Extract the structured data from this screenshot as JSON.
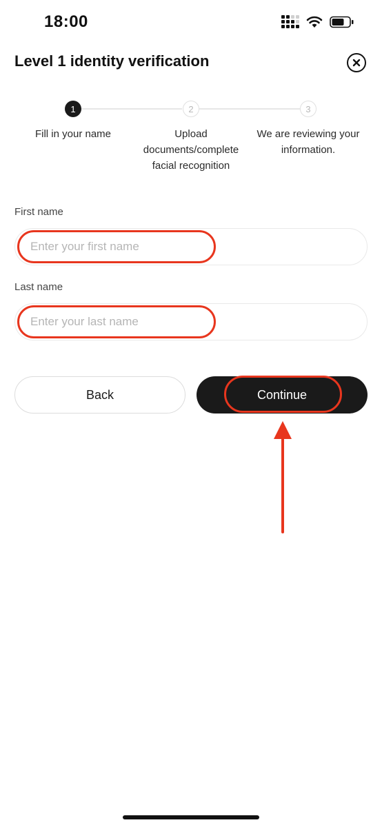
{
  "status_bar": {
    "time": "18:00",
    "signal_icon": "cellular-signal-icon",
    "wifi_icon": "wifi-icon",
    "battery_icon": "battery-icon"
  },
  "header": {
    "title": "Level 1 identity verification",
    "close_icon": "close-circle-icon"
  },
  "stepper": {
    "steps": [
      {
        "number": "1",
        "label": "Fill in your name",
        "active": true
      },
      {
        "number": "2",
        "label": "Upload documents/complete facial recognition",
        "active": false
      },
      {
        "number": "3",
        "label": "We are reviewing your information.",
        "active": false
      }
    ]
  },
  "form": {
    "first_name": {
      "label": "First name",
      "placeholder": "Enter your first name",
      "value": ""
    },
    "last_name": {
      "label": "Last name",
      "placeholder": "Enter your last name",
      "value": ""
    }
  },
  "buttons": {
    "back_label": "Back",
    "continue_label": "Continue"
  },
  "colors": {
    "annotation": "#e8361e",
    "primary_button": "#1a1a1a",
    "active_step": "#1a1a1a"
  }
}
